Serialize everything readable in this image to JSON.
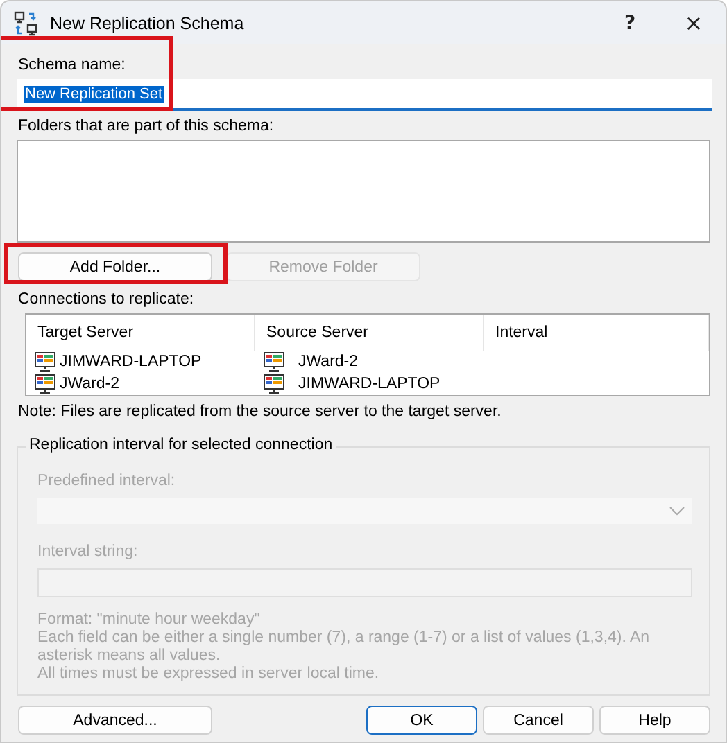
{
  "window": {
    "title": "New Replication Schema",
    "help_button": "?",
    "close_button": "×"
  },
  "schema_name": {
    "label": "Schema name:",
    "value": "New Replication Set",
    "text_selected": true,
    "highlighted": true
  },
  "folders": {
    "label": "Folders that are part of this schema:"
  },
  "folder_buttons": [
    {
      "label": "Add Folder...",
      "disabled": false,
      "highlighted": true
    },
    {
      "label": "Remove Folder",
      "disabled": true,
      "highlighted": false
    }
  ],
  "connections": {
    "label": "Connections to replicate:",
    "columns": [
      "Target Server",
      "Source Server",
      "Interval"
    ],
    "rows": [
      {
        "target": "JIMWARD-LAPTOP",
        "source": "JWard-2",
        "interval_text": ""
      },
      {
        "target": "JWard-2",
        "source": "JIMWARD-LAPTOP",
        "interval_text": ""
      }
    ]
  },
  "note": "Note: Files are replicated from the source server to the target server.",
  "interval_group": {
    "title": "Replication interval for selected connection",
    "disabled": true,
    "predefined_label": "Predefined interval:",
    "string_label": "Interval string:",
    "help_lines": [
      "Format: \"minute hour weekday\"",
      "Each field can be either a single number (7), a range (1-7) or a list of values (1,3,4). An asterisk means all values.",
      "All times must be expressed in server local time."
    ]
  },
  "buttons": [
    {
      "label": "Advanced...",
      "default": false
    },
    {
      "label": "OK",
      "default": true
    },
    {
      "label": "Cancel",
      "default": false
    },
    {
      "label": "Help",
      "default": false
    }
  ]
}
